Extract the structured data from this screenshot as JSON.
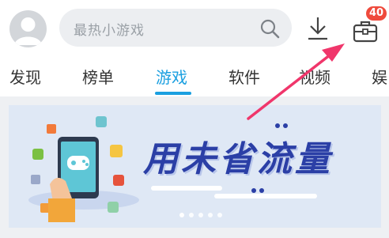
{
  "header": {
    "search_placeholder": "最热小游戏",
    "badge_count": "40",
    "icons": {
      "avatar": "user-avatar",
      "search": "search-icon",
      "download": "download-icon",
      "toolbox": "toolbox-icon"
    }
  },
  "tabs": [
    {
      "label": "发现"
    },
    {
      "label": "榜单"
    },
    {
      "label": "游戏",
      "active": true
    },
    {
      "label": "软件"
    },
    {
      "label": "视频"
    },
    {
      "label": "娱"
    }
  ],
  "banner": {
    "title": "用未省流量",
    "page_count": 5,
    "active_page": 0
  },
  "colors": {
    "accent": "#1a9fe0",
    "badge": "#ef4a3c",
    "arrow": "#f0366b",
    "banner_bg": "#dfe8f5"
  }
}
